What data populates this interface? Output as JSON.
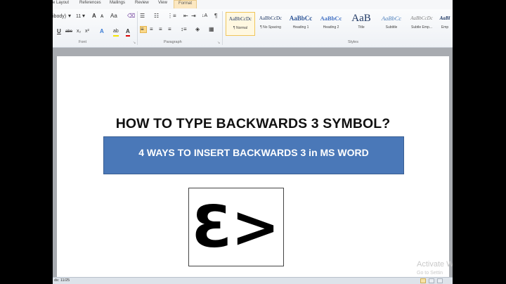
{
  "ribbon": {
    "tabs": [
      "e Layout",
      "References",
      "Mailings",
      "Review",
      "View",
      "Format"
    ],
    "font": {
      "name": "ibody)",
      "size": "11",
      "grow": "A",
      "shrink": "A",
      "change_case": "Aa",
      "clear_format": "⌫",
      "underline": "U",
      "strike": "abe",
      "subscript": "x₂",
      "superscript": "x²",
      "text_effects": "A",
      "highlight": "ab",
      "font_color": "A",
      "group_label": "Font"
    },
    "paragraph": {
      "group_label": "Paragraph",
      "pilcrow": "¶",
      "sort": "↓A"
    },
    "styles": {
      "group_label": "Styles",
      "items": [
        {
          "sample": "AaBbCcDc",
          "name": "¶ Normal"
        },
        {
          "sample": "AaBbCcDc",
          "name": "¶ No Spacing"
        },
        {
          "sample": "AaBbCc",
          "name": "Heading 1"
        },
        {
          "sample": "AaBbCc",
          "name": "Heading 2"
        },
        {
          "sample": "AaB",
          "name": "Title"
        },
        {
          "sample": "AaBbCc",
          "name": "Subtitle"
        },
        {
          "sample": "AaBbCcDc",
          "name": "Subtle Emp..."
        },
        {
          "sample": "AaBl",
          "name": "Emp"
        }
      ]
    }
  },
  "document": {
    "title": "HOW TO TYPE BACKWARDS 3 SYMBOL?",
    "banner": "4 WAYS TO INSERT BACKWARDS 3 in MS WORD",
    "symbol_three": "3",
    "symbol_arrow": ">"
  },
  "watermark": {
    "line1": "Activate W",
    "line2": "Go to Settin"
  },
  "status": {
    "words": "ds: 11/25"
  },
  "colors": {
    "banner": "#4a78b8",
    "format_tab": "#fce8c2",
    "doc_bg": "#a8abb0"
  }
}
